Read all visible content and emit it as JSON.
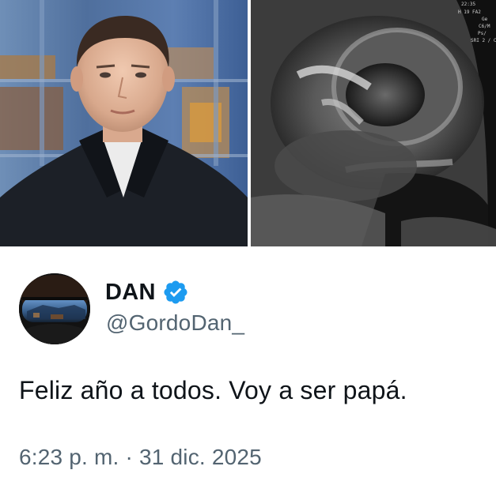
{
  "tweet": {
    "author": {
      "display_name": "DAN",
      "handle": "@GordoDan_",
      "verified": true,
      "verified_color": "#1d9bf0"
    },
    "text": "Feliz año a todos. Voy a ser papá.",
    "timestamp": "6:23 p. m. · 31 dic. 2025",
    "media": [
      {
        "kind": "photo",
        "subject": "portrait-photo"
      },
      {
        "kind": "photo",
        "subject": "ultrasound-image"
      }
    ]
  },
  "colors": {
    "text_primary": "#0f1419",
    "text_secondary": "#536471",
    "background": "#ffffff"
  }
}
